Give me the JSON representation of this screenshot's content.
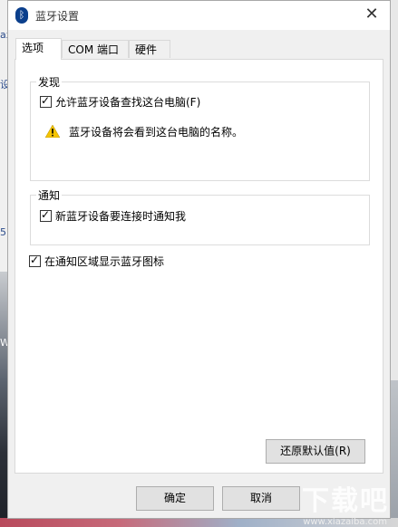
{
  "window": {
    "title": "蓝牙设置",
    "close_symbol": "✕"
  },
  "tabs": [
    {
      "label": "选项",
      "active": true
    },
    {
      "label": "COM 端口",
      "active": false
    },
    {
      "label": "硬件",
      "active": false
    }
  ],
  "discovery": {
    "label": "发现",
    "allow_label": "允许蓝牙设备查找这台电脑(F)",
    "allow_checked": true,
    "warning_text": "蓝牙设备将会看到这台电脑的名称。"
  },
  "notify": {
    "label": "通知",
    "new_device_label": "新蓝牙设备要连接时通知我",
    "new_device_checked": true
  },
  "tray": {
    "label": "在通知区域显示蓝牙图标",
    "checked": true
  },
  "buttons": {
    "restore_defaults": "还原默认值(R)",
    "ok": "确定",
    "cancel": "取消"
  },
  "background": {
    "fragments": [
      "ax",
      "设",
      "5)",
      "Wi"
    ],
    "watermark": "下载吧",
    "watermark_url": "www.xiazaiba.com"
  },
  "colors": {
    "dialog_bg": "#f0f0f0",
    "panel_bg": "#ffffff",
    "bluetooth_blue": "#0b3f8c",
    "warning_yellow": "#f5c400"
  },
  "icons": {
    "bluetooth": "bluetooth-icon",
    "warning": "warning-icon",
    "close": "close-icon"
  }
}
